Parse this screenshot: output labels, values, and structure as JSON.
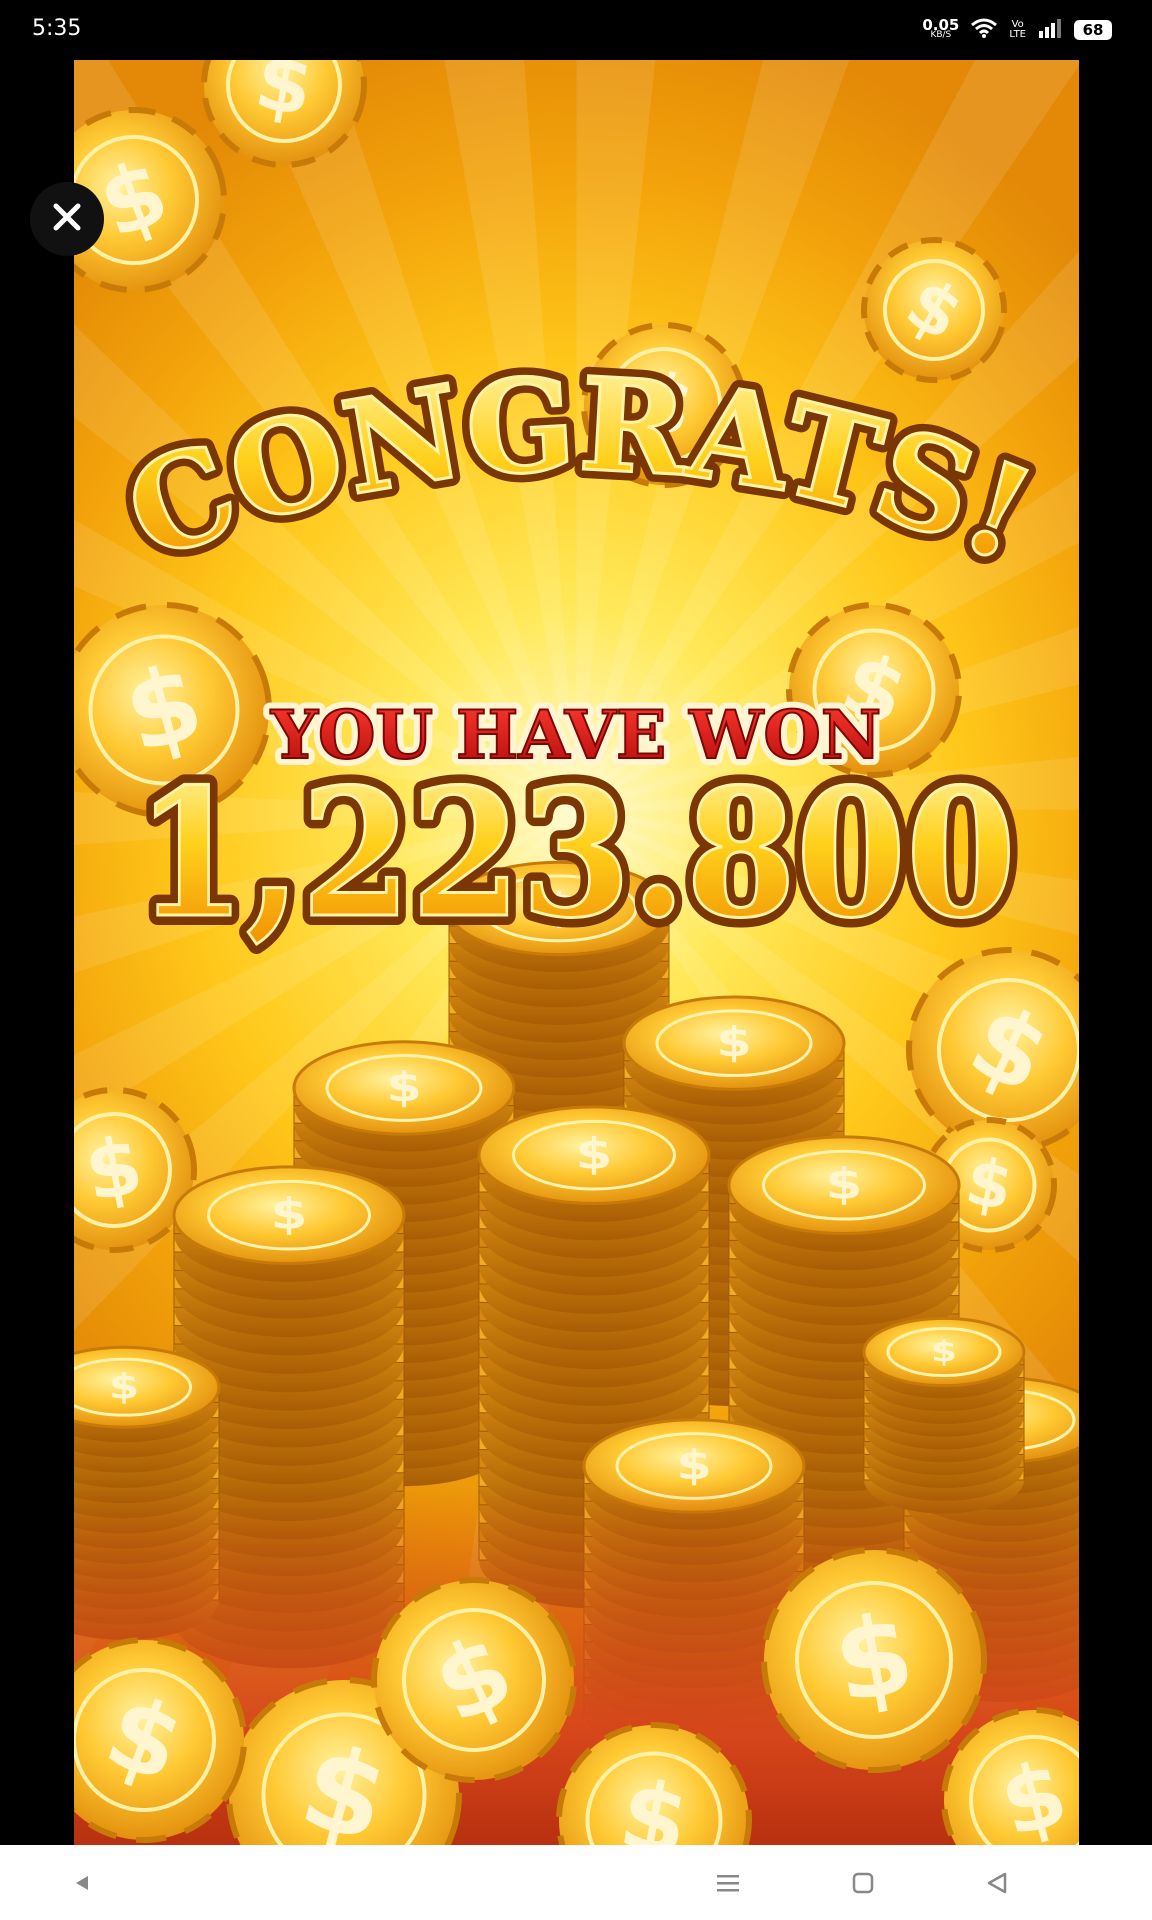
{
  "status_bar": {
    "time": "5:35",
    "net_speed_value": "0.05",
    "net_speed_unit": "KB/S",
    "volte_top": "Vo",
    "volte_bottom": "LTE",
    "battery": "68",
    "icons": [
      "wifi-icon",
      "volte-icon",
      "signal-icon",
      "battery-icon"
    ]
  },
  "game": {
    "headline": "CONGRATS!",
    "subtitle": "YOU HAVE WON",
    "amount": "1,223.800",
    "colors": {
      "gold": "#ffd12a",
      "gold_light": "#fff4a8",
      "outline_brown": "#7a3605",
      "subtitle_red": "#d41616",
      "floor_red": "#c73a12"
    },
    "close_icon": "close-icon",
    "coin_icon": "dollar-coin-icon"
  },
  "nav_bar": {
    "icons": [
      "back-small-icon",
      "menu-icon",
      "home-square-icon",
      "back-triangle-icon"
    ]
  }
}
